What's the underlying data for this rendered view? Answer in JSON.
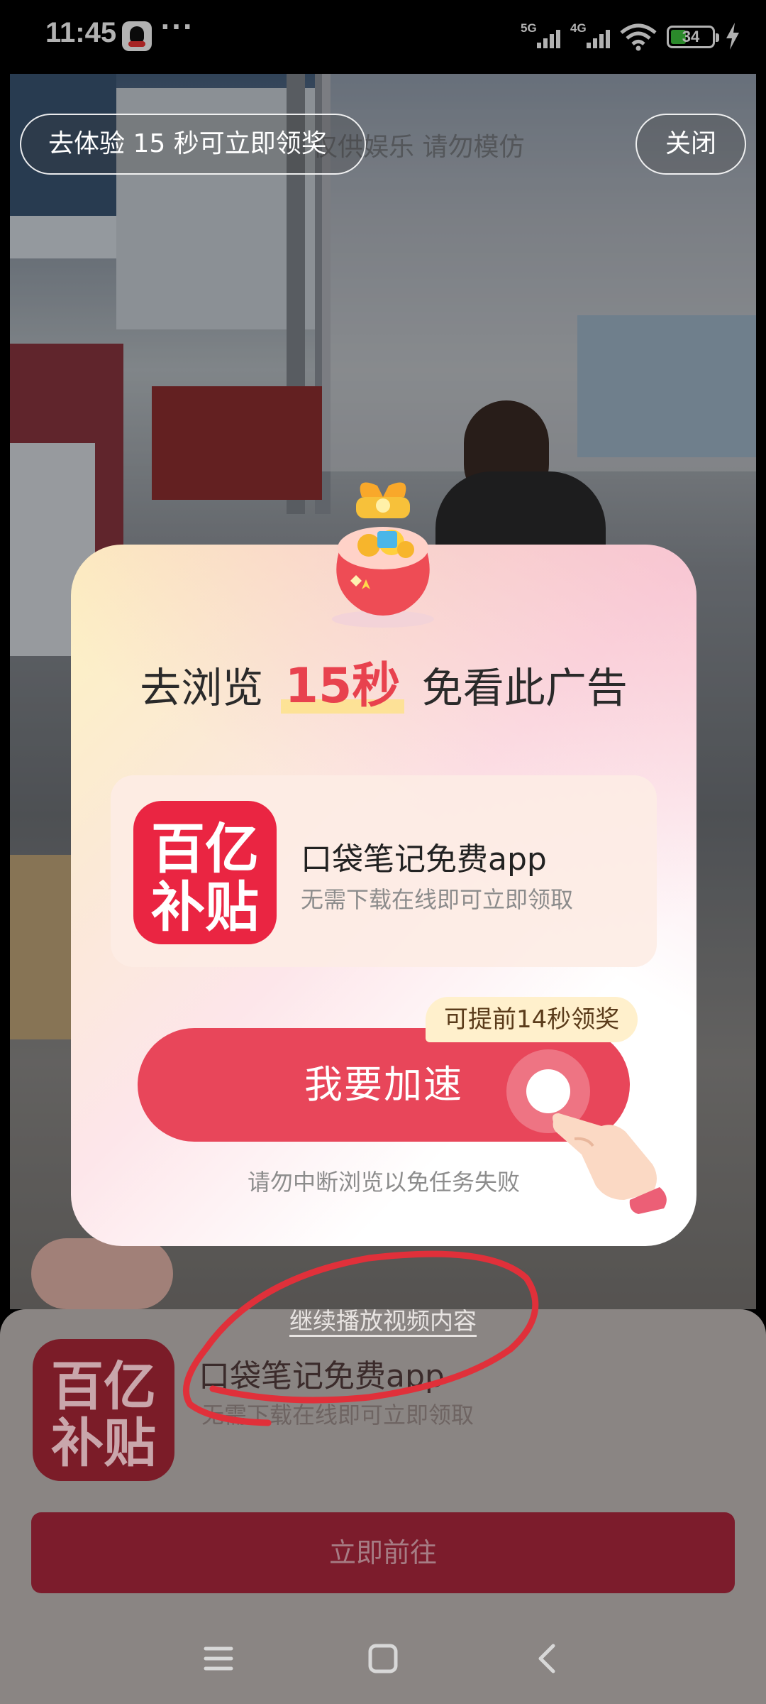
{
  "status_bar": {
    "time": "11:45",
    "more": "···",
    "network_1": "5G",
    "network_2": "4G",
    "battery": "34"
  },
  "top_bar": {
    "task_label": "去体验 15 秒可立即领奖",
    "watermark": "仅供娱乐 请勿模仿",
    "close_label": "关闭"
  },
  "dialog": {
    "headline_prefix": "去浏览",
    "headline_highlight": "15秒",
    "headline_suffix": "免看此广告",
    "app_logo_line1": "百亿",
    "app_logo_line2": "补贴",
    "app_title": "口袋笔记免费app",
    "app_subtitle": "无需下载在线即可立即领取",
    "reward_tag": "可提前14秒领奖",
    "speed_button": "我要加速",
    "warning": "请勿中断浏览以免任务失败"
  },
  "continue_link": "继续播放视频内容",
  "ad_sheet": {
    "logo_line1": "百亿",
    "logo_line2": "补贴",
    "title": "口袋笔记免费app",
    "subtitle": "无需下载在线即可立即领取",
    "cta": "立即前往"
  },
  "nav_bar": {
    "icons": [
      "menu-icon",
      "home-icon",
      "back-icon"
    ]
  },
  "colors": {
    "accent_red": "#e8465a",
    "tag_bg": "#fff0cc",
    "scribble": "#e0303a"
  }
}
